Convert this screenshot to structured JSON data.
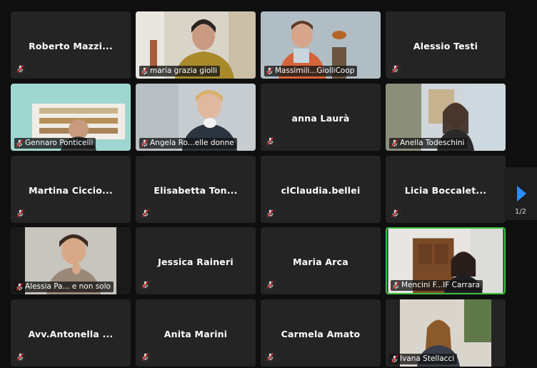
{
  "meeting": {
    "participants": [
      {
        "name": "Roberto Mazzi...",
        "video": false
      },
      {
        "name": "maria grazia giolli",
        "video": true
      },
      {
        "name": "Massimili...GiolliCoop",
        "video": true
      },
      {
        "name": "Alessio Testi",
        "video": false
      },
      {
        "name": "Gennaro Ponticelli",
        "video": true
      },
      {
        "name": "Angela Ro...elle donne",
        "video": true
      },
      {
        "name": "anna Laurà",
        "video": false
      },
      {
        "name": "Anella Todeschini",
        "video": true
      },
      {
        "name": "Martina Ciccio...",
        "video": false
      },
      {
        "name": "Elisabetta Ton...",
        "video": false
      },
      {
        "name": "clClaudia.bellei",
        "video": false
      },
      {
        "name": "Licia Boccalet...",
        "video": false
      },
      {
        "name": "Alessia Pa... e non solo",
        "video": true
      },
      {
        "name": "Jessica Raineri",
        "video": false
      },
      {
        "name": "Maria Arca",
        "video": false
      },
      {
        "name": "Mencini F...IF Carrara",
        "video": true,
        "active_speaker": true
      },
      {
        "name": "Avv.Antonella ...",
        "video": false
      },
      {
        "name": "Anita Marini",
        "video": false
      },
      {
        "name": "Carmela Amato",
        "video": false
      },
      {
        "name": "Ivana Stellacci",
        "video": true
      }
    ],
    "pagination": {
      "label": "1/2"
    },
    "icons": {
      "muted": "mic-muted-icon",
      "next": "next-page-arrow-icon"
    },
    "colors": {
      "tile_bg": "#242424",
      "active_border": "#39c23d",
      "muted_red": "#e0242b",
      "accent": "#2d8cff"
    }
  }
}
